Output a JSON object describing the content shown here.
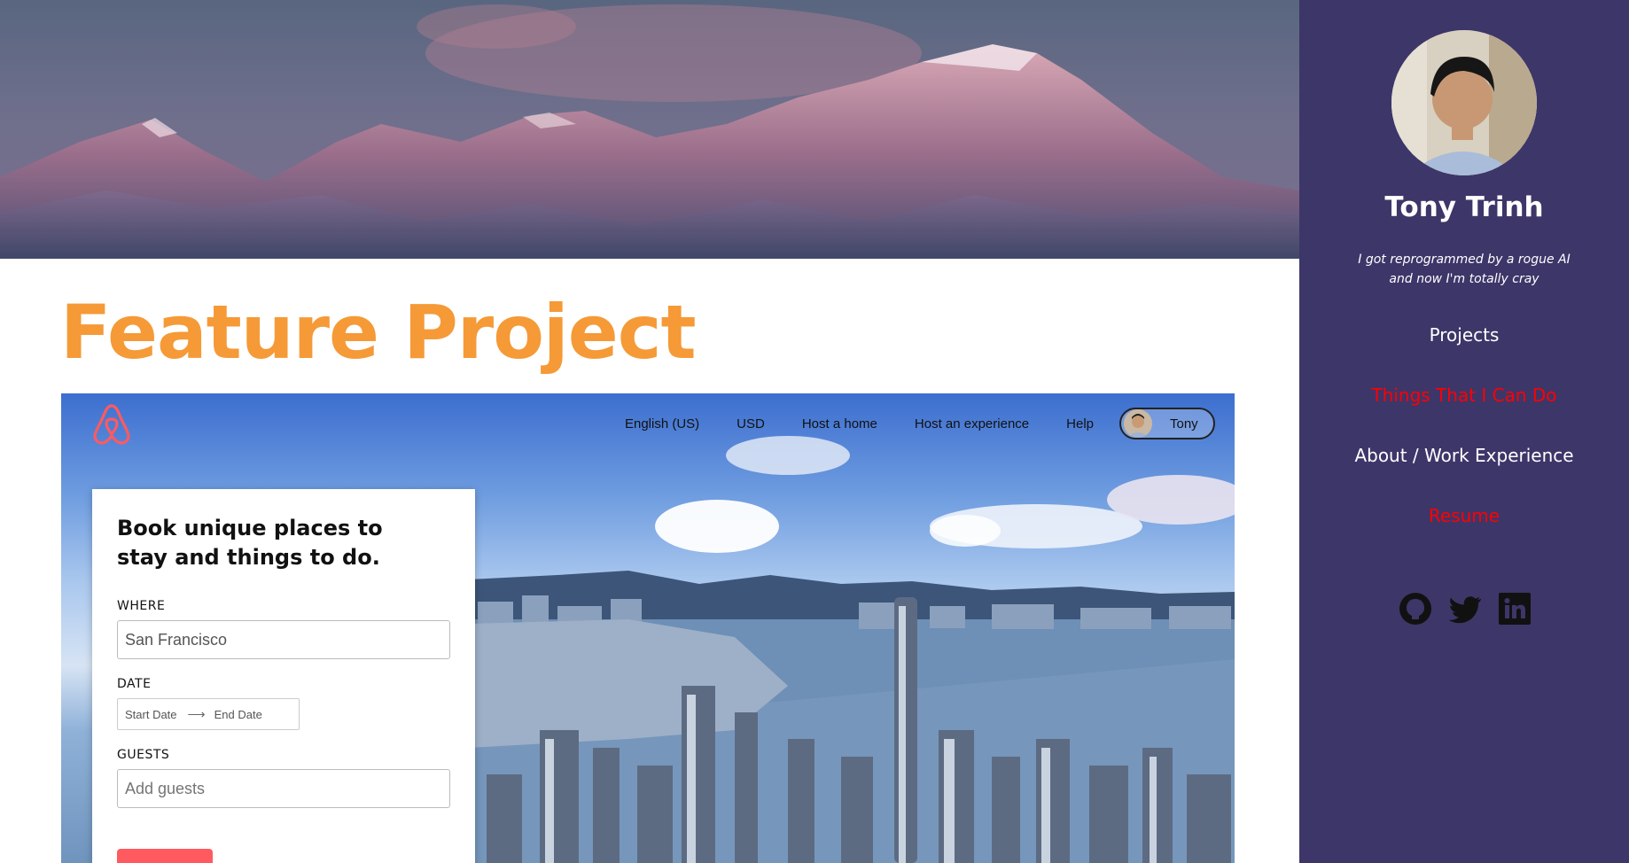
{
  "main": {
    "title": "Feature Project"
  },
  "feature": {
    "nav": {
      "links": [
        "English (US)",
        "USD",
        "Host a home",
        "Host an experience",
        "Help"
      ],
      "user": "Tony"
    },
    "card": {
      "heading": "Book unique places to stay and things to do.",
      "where_label": "WHERE",
      "where_value": "San Francisco",
      "date_label": "DATE",
      "start_placeholder": "Start Date",
      "end_placeholder": "End Date",
      "guests_label": "GUESTS",
      "guests_placeholder": "Add guests"
    }
  },
  "sidebar": {
    "name": "Tony Trinh",
    "tagline": "I got reprogrammed by a rogue AI and now I'm totally cray",
    "links": [
      {
        "label": "Projects",
        "color": "#ffffff"
      },
      {
        "label": "Things That I Can Do",
        "color": "#ff0000"
      },
      {
        "label": "About / Work Experience",
        "color": "#ffffff"
      },
      {
        "label": "Resume",
        "color": "#ff0000"
      }
    ],
    "socials": [
      "github-icon",
      "twitter-icon",
      "linkedin-icon"
    ]
  },
  "colors": {
    "title": "#f59a37",
    "sidebar_bg": "#3d3669",
    "airbnb": "#ff5a5f"
  }
}
